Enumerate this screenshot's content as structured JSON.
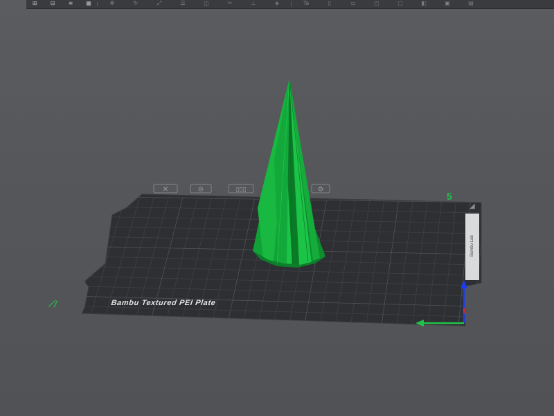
{
  "toolbar": {
    "items": [
      {
        "icon": "add-icon",
        "glyph": "⊞"
      },
      {
        "icon": "plate-icon",
        "glyph": "⊟"
      },
      {
        "icon": "menu-icon",
        "glyph": "≡"
      },
      {
        "icon": "grid-icon",
        "glyph": "▦"
      },
      {
        "icon": "move-icon",
        "glyph": "✥"
      },
      {
        "icon": "rotate-icon",
        "glyph": "↻"
      },
      {
        "icon": "scale-icon",
        "glyph": "⤢"
      },
      {
        "icon": "arrange-icon",
        "glyph": "☰"
      },
      {
        "icon": "orient-icon",
        "glyph": "◫"
      },
      {
        "icon": "cut-icon",
        "glyph": "✂"
      },
      {
        "icon": "support-icon",
        "glyph": "⊥"
      },
      {
        "icon": "seam-icon",
        "glyph": "◈"
      },
      {
        "icon": "text-icon",
        "glyph": "Ta"
      },
      {
        "icon": "measure-icon",
        "glyph": "▯"
      },
      {
        "icon": "assembly-icon",
        "glyph": "▭"
      },
      {
        "icon": "layer-icon",
        "glyph": "◰"
      },
      {
        "icon": "view-icon",
        "glyph": "▢"
      },
      {
        "icon": "split-icon",
        "glyph": "◧"
      },
      {
        "icon": "paint-icon",
        "glyph": "▣"
      },
      {
        "icon": "settings-icon",
        "glyph": "▤"
      }
    ]
  },
  "scene": {
    "plate_label": "Bambu Textured PEI Plate",
    "plate_number": "5",
    "side_text": "Bambu Lab",
    "colors": {
      "background": "#55575b",
      "plate": "#2e2f32",
      "grid": "#4a4b4f",
      "model": "#12a83a",
      "model_dark": "#0b7f2a",
      "model_light": "#1fd04b",
      "accent_green": "#22c24a",
      "axis_blue": "#1a3cf0",
      "axis_red": "#e02424"
    }
  }
}
